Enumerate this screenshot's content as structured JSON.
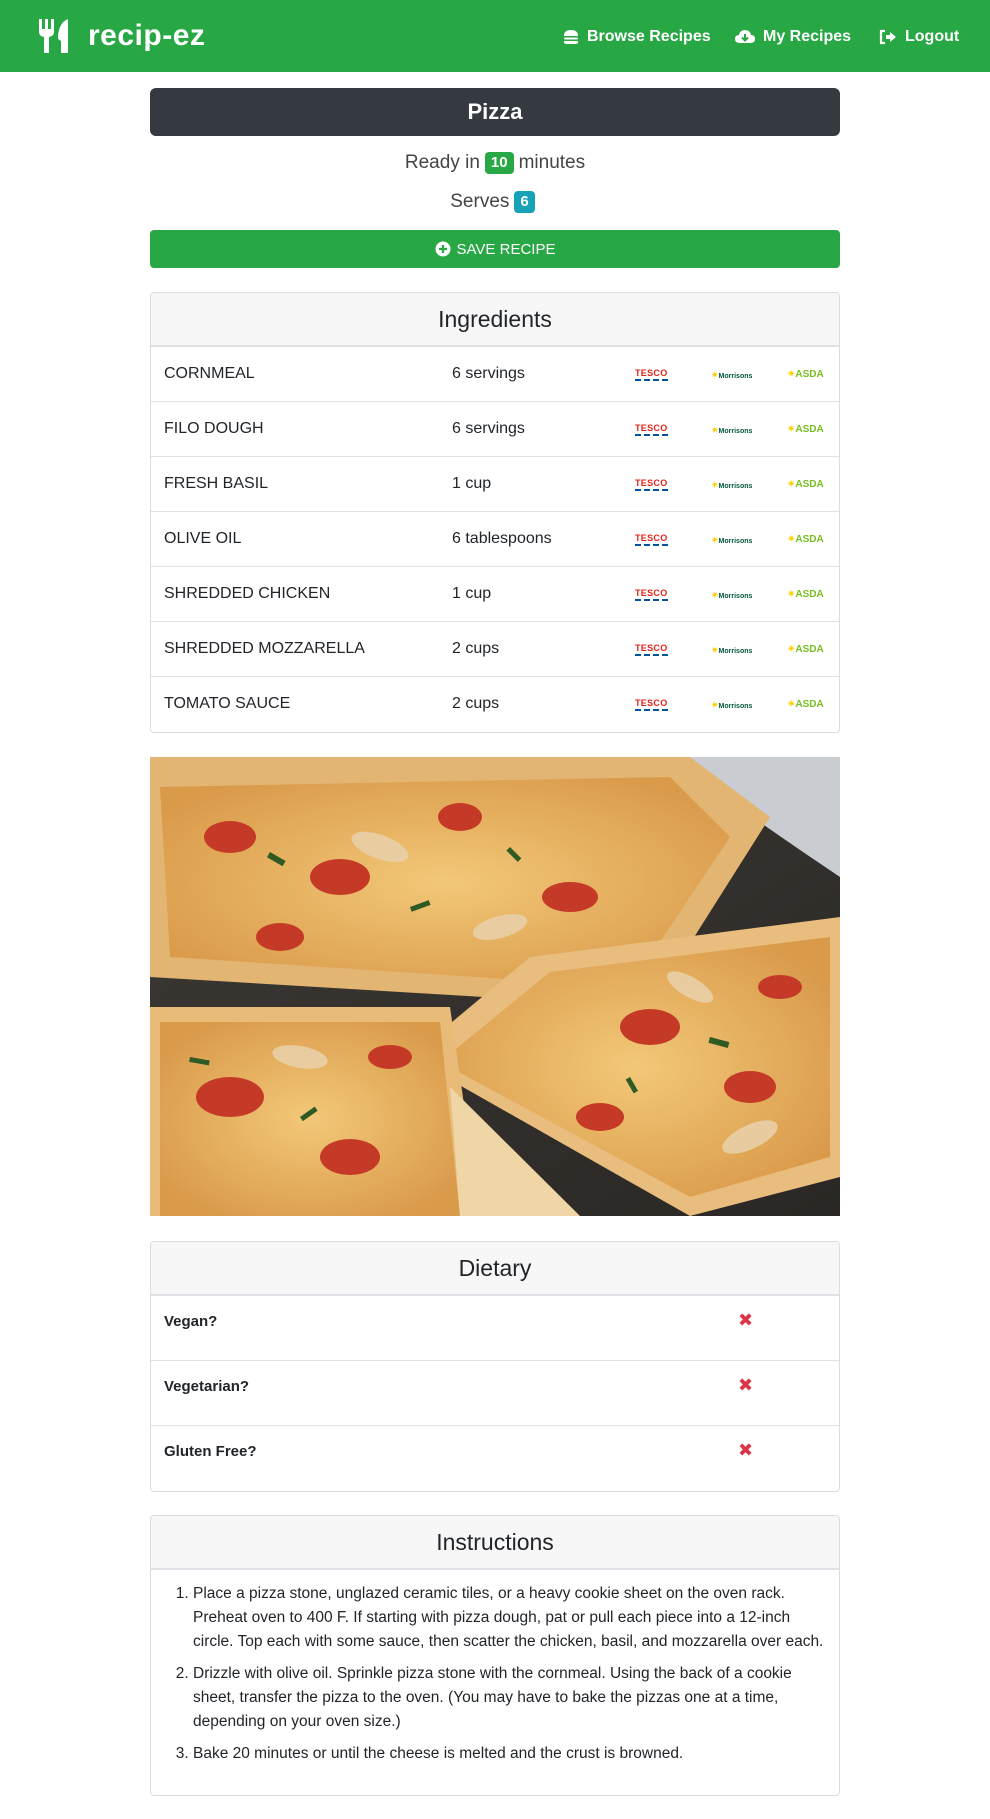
{
  "nav": {
    "brand": "recip-ez",
    "items": [
      {
        "label": "Browse Recipes",
        "icon": "hamburger-icon"
      },
      {
        "label": "My Recipes",
        "icon": "cloud-download-icon"
      },
      {
        "label": "Logout",
        "icon": "sign-out-icon"
      }
    ]
  },
  "recipe": {
    "title": "Pizza",
    "ready_prefix": "Ready in",
    "ready_minutes": "10",
    "ready_suffix": "minutes",
    "serves_label": "Serves",
    "serves_count": "6",
    "save_label": "SAVE RECIPE"
  },
  "ingredients": {
    "header": "Ingredients",
    "stores": [
      "TESCO",
      "Morrisons",
      "ASDA"
    ],
    "rows": [
      {
        "name": "CORNMEAL",
        "amount": "6 servings"
      },
      {
        "name": "FILO DOUGH",
        "amount": "6 servings"
      },
      {
        "name": "FRESH BASIL",
        "amount": "1 cup"
      },
      {
        "name": "OLIVE OIL",
        "amount": "6 tablespoons"
      },
      {
        "name": "SHREDDED CHICKEN",
        "amount": "1 cup"
      },
      {
        "name": "SHREDDED MOZZARELLA",
        "amount": "2 cups"
      },
      {
        "name": "TOMATO SAUCE",
        "amount": "2 cups"
      }
    ]
  },
  "dietary": {
    "header": "Dietary",
    "rows": [
      {
        "label": "Vegan?",
        "value": "✖"
      },
      {
        "label": "Vegetarian?",
        "value": "✖"
      },
      {
        "label": "Gluten Free?",
        "value": "✖"
      }
    ]
  },
  "instructions": {
    "header": "Instructions",
    "steps": [
      "Place a pizza stone, unglazed ceramic tiles, or a heavy cookie sheet on the oven rack. Preheat oven to 400 F. If starting with pizza dough, pat or pull each piece into a 12-inch circle. Top each with some sauce, then scatter the chicken, basil, and mozzarella over each.",
      "Drizzle with olive oil. Sprinkle pizza stone with the cornmeal. Using the back of a cookie sheet, transfer the pizza to the oven. (You may have to bake the pizzas one at a time, depending on your oven size.)",
      "Bake 20 minutes or until the cheese is melted and the crust is browned."
    ]
  },
  "colors": {
    "primary_green": "#28a745",
    "dark": "#343a40",
    "info": "#17a2b8",
    "danger": "#dc3545"
  }
}
